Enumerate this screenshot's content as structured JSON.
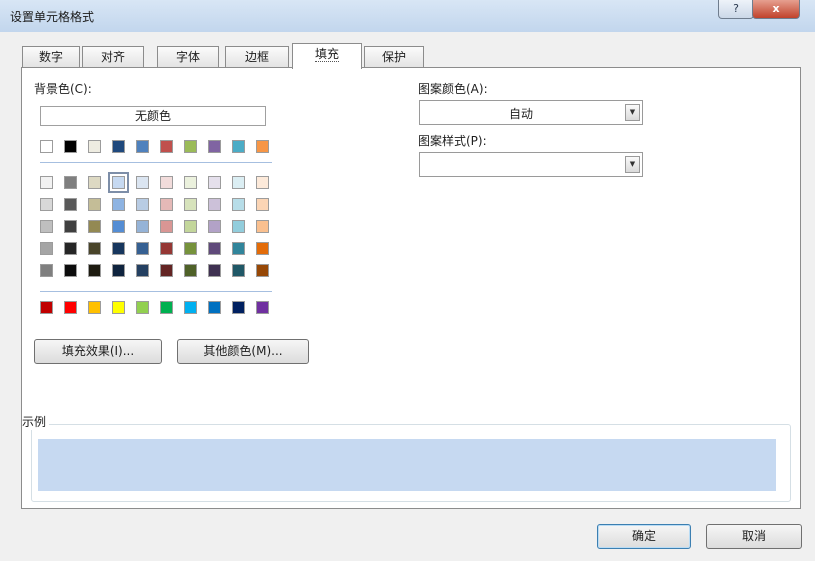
{
  "window": {
    "title": "设置单元格格式",
    "help_label": "?",
    "close_label": "x"
  },
  "tabs": [
    {
      "label": "数字"
    },
    {
      "label": "对齐"
    },
    {
      "label": "字体"
    },
    {
      "label": "边框"
    },
    {
      "label": "填充",
      "active": true
    },
    {
      "label": "保护"
    }
  ],
  "fill": {
    "background_label": "背景色(C):",
    "no_color_label": "无颜色",
    "selected_color": "#c6d9f1",
    "palette_row1": [
      "#ffffff",
      "#000000",
      "#eeece1",
      "#1f497d",
      "#4f81bd",
      "#c0504d",
      "#9bbb59",
      "#8064a2",
      "#4bacc6",
      "#f79646"
    ],
    "palette_tints": [
      [
        "#f2f2f2",
        "#7f7f7f",
        "#ddd9c3",
        "#c6d9f1",
        "#dbe5f1",
        "#f2dcdb",
        "#ebf1dd",
        "#e5e0ec",
        "#dbeef3",
        "#fdeada"
      ],
      [
        "#d8d8d8",
        "#595959",
        "#c4bd97",
        "#8db3e2",
        "#b8cce4",
        "#e5b9b7",
        "#d7e3bc",
        "#ccc1d9",
        "#b7dde8",
        "#fbd5b5"
      ],
      [
        "#bfbfbf",
        "#3f3f3f",
        "#938953",
        "#548dd4",
        "#95b3d7",
        "#d99694",
        "#c3d69b",
        "#b2a2c7",
        "#92cddc",
        "#fac08f"
      ],
      [
        "#a5a5a5",
        "#262626",
        "#494429",
        "#17365d",
        "#366092",
        "#953734",
        "#76923c",
        "#5f497a",
        "#31859b",
        "#e36c09"
      ],
      [
        "#7f7f7f",
        "#0c0c0c",
        "#1d1b10",
        "#0f243e",
        "#244061",
        "#632423",
        "#4f6128",
        "#3f3151",
        "#205867",
        "#974806"
      ]
    ],
    "palette_standard": [
      "#c00000",
      "#ff0000",
      "#ffc000",
      "#ffff00",
      "#92d050",
      "#00b050",
      "#00b0f0",
      "#0070c0",
      "#002060",
      "#7030a0"
    ],
    "fill_effects_label": "填充效果(I)...",
    "more_colors_label": "其他颜色(M)..."
  },
  "pattern": {
    "color_label": "图案颜色(A):",
    "color_value": "自动",
    "style_label": "图案样式(P):",
    "style_value": ""
  },
  "sample": {
    "label": "示例",
    "fill_color": "#c6d9f1"
  },
  "footer": {
    "ok_label": "确定",
    "cancel_label": "取消"
  }
}
